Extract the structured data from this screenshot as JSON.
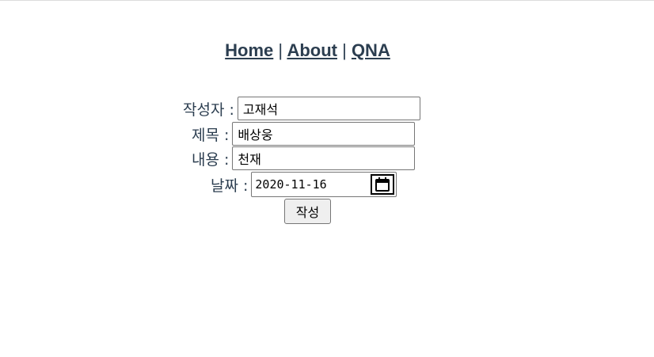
{
  "nav": {
    "links": [
      {
        "label": "Home"
      },
      {
        "label": "About"
      },
      {
        "label": "QNA"
      }
    ],
    "separator": "|"
  },
  "form": {
    "author": {
      "label": "작성자 :",
      "value": "고재석"
    },
    "title": {
      "label": "제목 :",
      "value": "배상웅"
    },
    "content": {
      "label": "내용 :",
      "value": "천재"
    },
    "date": {
      "label": "날짜 :",
      "value": "2020-11-16",
      "icon": "calendar-icon"
    },
    "submit_label": "작성"
  },
  "colors": {
    "text": "#2c3e50",
    "border": "#767676",
    "button_bg": "#efefef"
  }
}
